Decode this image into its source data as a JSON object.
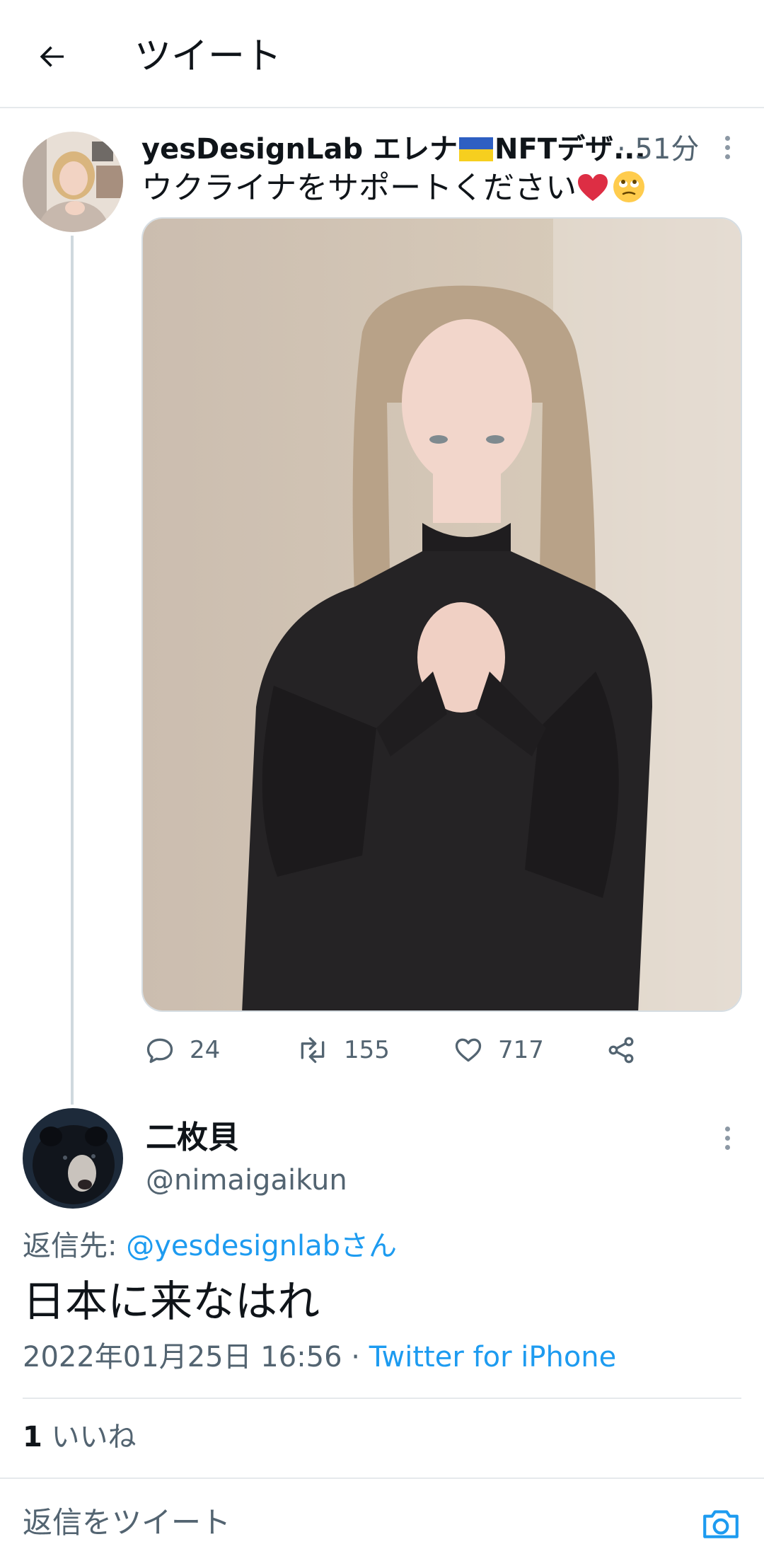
{
  "header": {
    "title": "ツイート"
  },
  "tweet": {
    "author_name_prefix": "yesDesignLab エレナ",
    "author_name_suffix": "NFTデザ...",
    "time": "· 51分",
    "text": "ウクライナをサポートください",
    "stats": {
      "replies": "24",
      "retweets": "155",
      "likes": "717"
    }
  },
  "reply": {
    "name": "二枚貝",
    "handle": "@nimaigaikun",
    "reply_to_label": "返信先: ",
    "reply_to_link": "@yesdesignlabさん",
    "body": "日本に来なはれ",
    "timestamp": "2022年01月25日 16:56 · ",
    "source": "Twitter for iPhone",
    "likes_count": "1",
    "likes_label": " いいね"
  },
  "compose": {
    "placeholder": "返信をツイート"
  },
  "icons": {
    "back": "arrow-left-icon",
    "more": "more-vertical-icon",
    "reply": "speech-bubble-icon",
    "retweet": "retweet-icon",
    "like": "heart-icon",
    "share": "share-icon",
    "camera": "camera-icon",
    "flag": "ukraine-flag-icon"
  },
  "colors": {
    "link": "#1d9bf0",
    "secondary_text": "#536471",
    "primary_text": "#0f1419",
    "divider": "#e6e9ec"
  }
}
